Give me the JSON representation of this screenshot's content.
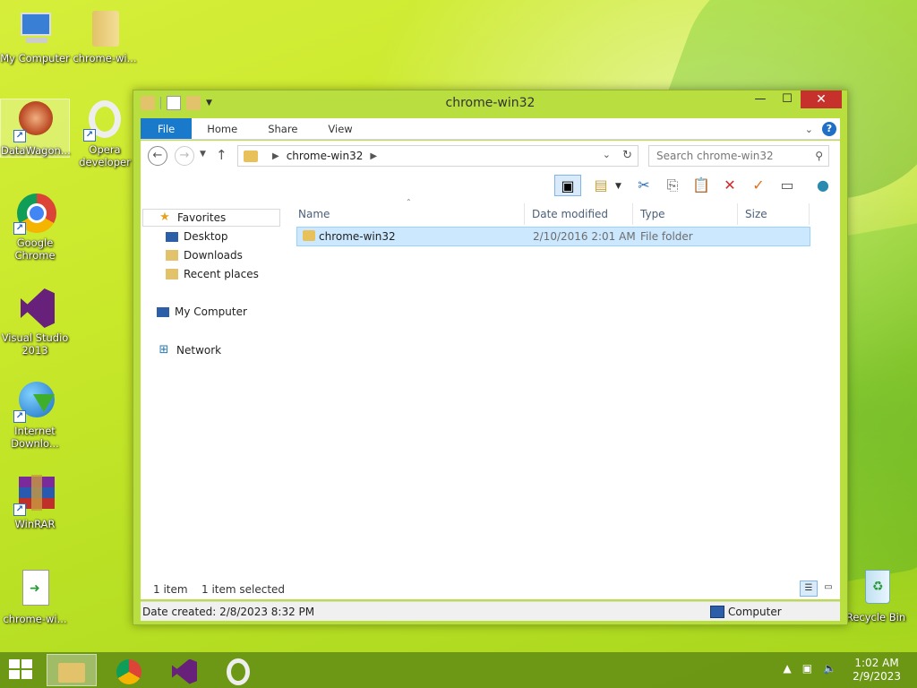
{
  "desktop": {
    "icons": [
      {
        "label": "My Computer"
      },
      {
        "label": "chrome-wi..."
      },
      {
        "label": "DataWagon..."
      },
      {
        "label": "Opera developer"
      },
      {
        "label": "Google Chrome"
      },
      {
        "label": "Visual Studio 2013"
      },
      {
        "label": "Internet Downlo..."
      },
      {
        "label": "WinRAR"
      },
      {
        "label": "chrome-wi..."
      },
      {
        "label": "Recycle Bin"
      }
    ]
  },
  "window": {
    "title": "chrome-win32",
    "ribbon_tabs": [
      "File",
      "Home",
      "Share",
      "View"
    ],
    "address": {
      "crumb": "chrome-win32"
    },
    "search_placeholder": "Search chrome-win32",
    "nav_pane": {
      "favorites": "Favorites",
      "desktop": "Desktop",
      "downloads": "Downloads",
      "recent": "Recent places",
      "computer": "My Computer",
      "network": "Network"
    },
    "columns": [
      "Name",
      "Date modified",
      "Type",
      "Size"
    ],
    "files": [
      {
        "name": "chrome-win32",
        "date": "2/10/2016 2:01 AM",
        "type": "File folder",
        "size": ""
      }
    ],
    "status": {
      "count": "1 item",
      "selected": "1 item selected"
    },
    "details": {
      "created": "Date created: 2/8/2023 8:32 PM",
      "location": "Computer"
    }
  },
  "taskbar": {
    "clock_time": "1:02 AM",
    "clock_date": "2/9/2023"
  },
  "colors": {
    "accent": "#1979ca",
    "selection": "#cce8ff",
    "close": "#c7312c"
  }
}
